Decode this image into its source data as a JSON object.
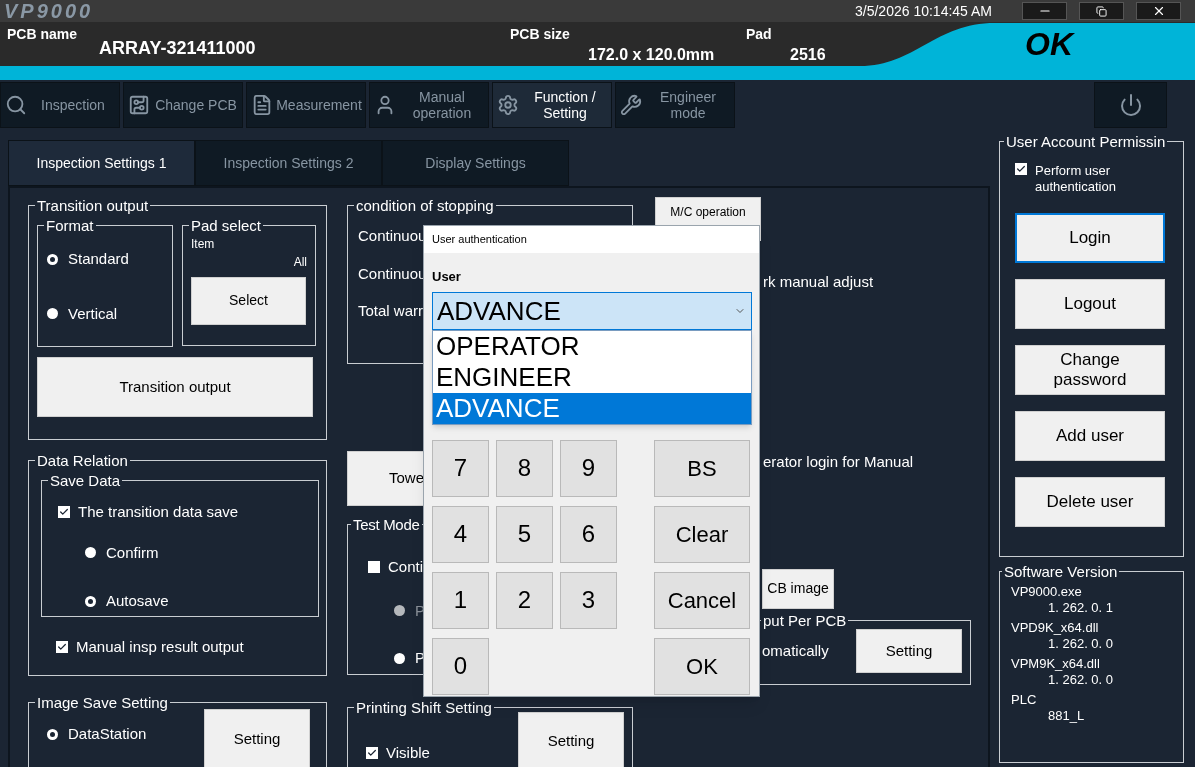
{
  "window": {
    "logo": "VP9000",
    "datetime": "3/5/2026 10:14:45 AM"
  },
  "header": {
    "pcb_name_label": "PCB name",
    "pcb_name": "ARRAY-321411000",
    "pcb_size_label": "PCB size",
    "pcb_size": "172.0 x 120.0mm",
    "pad_label": "Pad",
    "pad": "2516",
    "result": "OK"
  },
  "nav": [
    {
      "label": "Inspection",
      "selected": false
    },
    {
      "label": "Change PCB",
      "selected": false
    },
    {
      "label": "Measurement",
      "selected": false
    },
    {
      "label": "Manual operation",
      "selected": false
    },
    {
      "label": "Function / Setting",
      "selected": true
    },
    {
      "label": "Engineer mode",
      "selected": false
    }
  ],
  "tabs": [
    {
      "label": "Inspection Settings 1",
      "selected": true
    },
    {
      "label": "Inspection Settings 2",
      "selected": false
    },
    {
      "label": "Display Settings",
      "selected": false
    }
  ],
  "transition_output": {
    "title": "Transition output",
    "format": {
      "title": "Format",
      "options": [
        {
          "label": "Standard",
          "selected": true
        },
        {
          "label": "Vertical",
          "selected": false
        }
      ]
    },
    "pad_select": {
      "title": "Pad select",
      "item_label": "Item",
      "item_value": "All",
      "button": "Select"
    },
    "button": "Transition output"
  },
  "condition_of_stopping": {
    "title": "condition of stopping",
    "rows": [
      "Continuou",
      "Continuou",
      "Total warr"
    ]
  },
  "mc_operation_button": "M/C operation",
  "notes": [
    "rk manual adjust",
    "erator login for Manual"
  ],
  "data_relation": {
    "title": "Data Relation",
    "save_data": {
      "title": "Save Data",
      "transition_save": {
        "label": "The transition data save",
        "checked": true
      },
      "modes": [
        {
          "label": "Confirm",
          "selected": false
        },
        {
          "label": "Autosave",
          "selected": true
        }
      ]
    },
    "manual_output": {
      "label": "Manual insp result output",
      "checked": true
    }
  },
  "tower_button": "Towe",
  "test_mode": {
    "title": "Test Mode",
    "continuous": {
      "label": "Conti",
      "checked": false
    },
    "options": [
      {
        "label": "P",
        "selected": false,
        "disabled": true
      },
      {
        "label": "P",
        "selected": false,
        "disabled": false
      }
    ]
  },
  "pcb_image_button": "CB image",
  "output_per_pcb": {
    "title": "put Per PCB",
    "label": "omatically",
    "button": "Setting"
  },
  "image_save": {
    "title": "Image Save Setting",
    "options": [
      {
        "label": "DataStation",
        "selected": true
      }
    ],
    "button": "Setting"
  },
  "printing_shift": {
    "title": "Printing Shift Setting",
    "visible": {
      "label": "Visible",
      "checked": true
    },
    "button": "Setting"
  },
  "user_account": {
    "title": "User Account Permissin",
    "auth": {
      "label": "Perform user authentication",
      "checked": true
    },
    "buttons": [
      {
        "label": "Login",
        "focused": true
      },
      {
        "label": "Logout",
        "focused": false
      },
      {
        "label": "Change password",
        "focused": false
      },
      {
        "label": "Add user",
        "focused": false
      },
      {
        "label": "Delete user",
        "focused": false
      }
    ]
  },
  "software_version": {
    "title": "Software Version",
    "items": [
      {
        "name": "VP9000.exe",
        "version": "1. 262. 0. 1"
      },
      {
        "name": "VPD9K_x64.dll",
        "version": "1. 262. 0. 0"
      },
      {
        "name": "VPM9K_x64.dll",
        "version": "1. 262. 0. 0"
      },
      {
        "name": "PLC",
        "version": "881_L"
      }
    ]
  },
  "dialog": {
    "title": "User authentication",
    "user_label": "User",
    "user_value": "ADVANCE",
    "options": [
      {
        "label": "OPERATOR",
        "selected": false
      },
      {
        "label": "ENGINEER",
        "selected": false
      },
      {
        "label": "ADVANCE",
        "selected": true
      }
    ],
    "digits": [
      "7",
      "8",
      "9",
      "4",
      "5",
      "6",
      "1",
      "2",
      "3",
      "0"
    ],
    "actions": [
      "BS",
      "Clear",
      "Cancel",
      "OK"
    ]
  }
}
